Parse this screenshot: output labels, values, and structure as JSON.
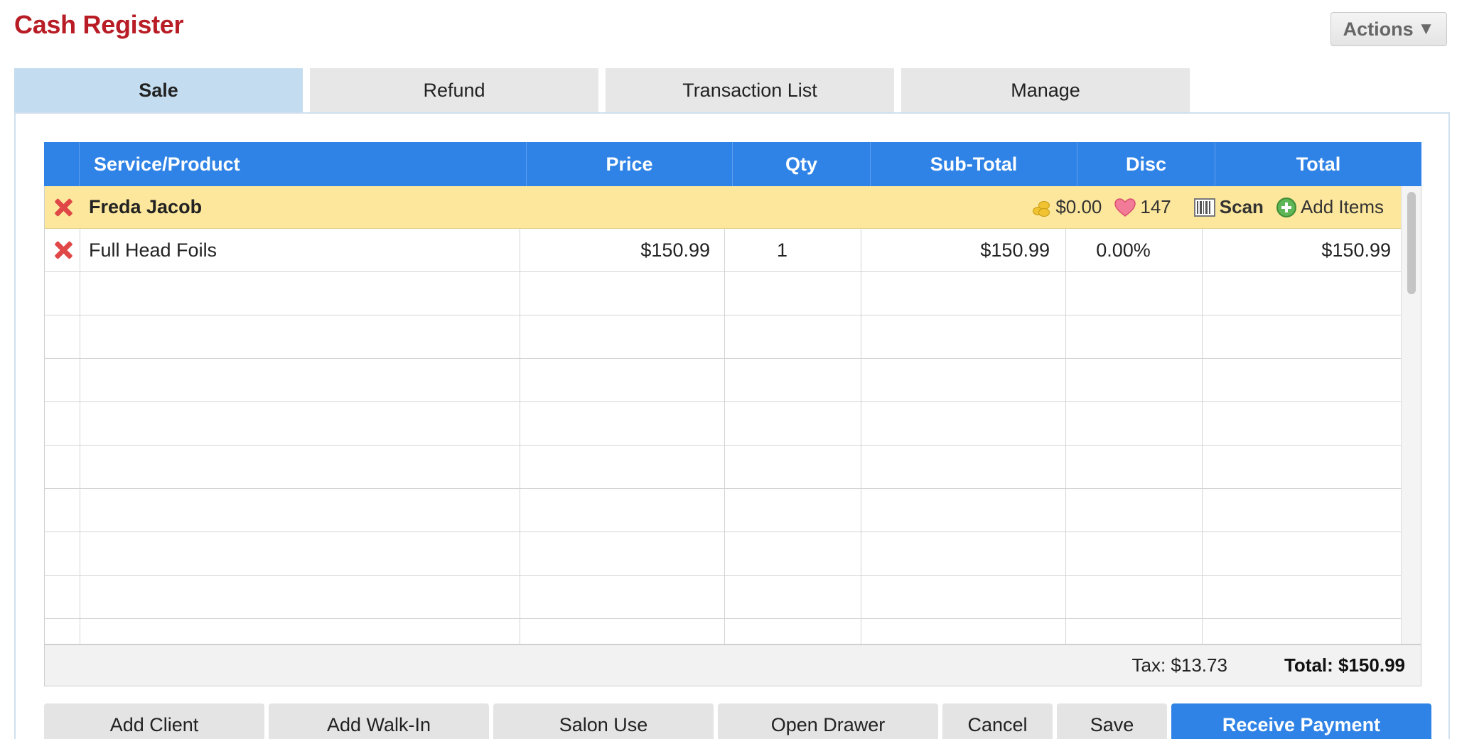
{
  "app": {
    "title": "Cash Register",
    "actions_label": "Actions"
  },
  "tabs": [
    {
      "label": "Sale",
      "active": true
    },
    {
      "label": "Refund",
      "active": false
    },
    {
      "label": "Transaction List",
      "active": false
    },
    {
      "label": "Manage",
      "active": false
    }
  ],
  "table": {
    "columns": [
      "",
      "Service/Product",
      "Price",
      "Qty",
      "Sub-Total",
      "Disc",
      "Total"
    ],
    "client": {
      "name": "Freda Jacob",
      "balance": "$0.00",
      "points": "147",
      "scan_label": "Scan",
      "add_items_label": "Add Items"
    },
    "items": [
      {
        "name": "Full Head Foils",
        "price": "$150.99",
        "qty": "1",
        "subtotal": "$150.99",
        "disc": "0.00%",
        "total": "$150.99"
      }
    ],
    "empty_rows": 8
  },
  "summary": {
    "tax": "Tax: $13.73",
    "total": "Total: $150.99"
  },
  "buttons": {
    "add_client": "Add Client",
    "add_walkin": "Add Walk-In",
    "salon_use": "Salon Use",
    "open_drawer": "Open Drawer",
    "cancel": "Cancel",
    "save": "Save",
    "receive_payment": "Receive Payment"
  },
  "colors": {
    "title_red": "#b81c25",
    "header_blue": "#2f83e6",
    "active_tab": "#c3dcef",
    "client_row": "#fde79c",
    "delete_red": "#e04848"
  },
  "icons": [
    "delete-icon",
    "coins-icon",
    "heart-icon",
    "barcode-icon",
    "add-circle-icon",
    "caret-down-icon"
  ]
}
